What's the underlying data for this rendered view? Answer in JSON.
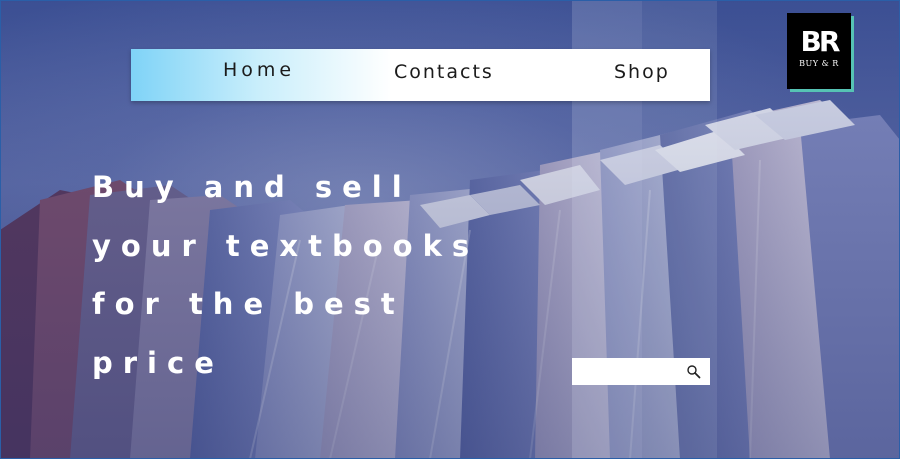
{
  "nav": {
    "home_label": "Home",
    "contacts_label": "Contacts",
    "shop_label": "Shop"
  },
  "logo": {
    "mark": "BR",
    "text": "BUY & R"
  },
  "hero": {
    "lines": [
      "Buy and sell",
      "your textbooks",
      "for the best",
      "price"
    ]
  },
  "search": {
    "value": "",
    "placeholder": "",
    "icon": "search-icon"
  },
  "colors": {
    "nav_gradient_start": "#7fd3f7",
    "logo_background": "#000000",
    "logo_accent": "#56c3b4",
    "headline_text": "#ffffff",
    "background": "#3b4f93"
  }
}
